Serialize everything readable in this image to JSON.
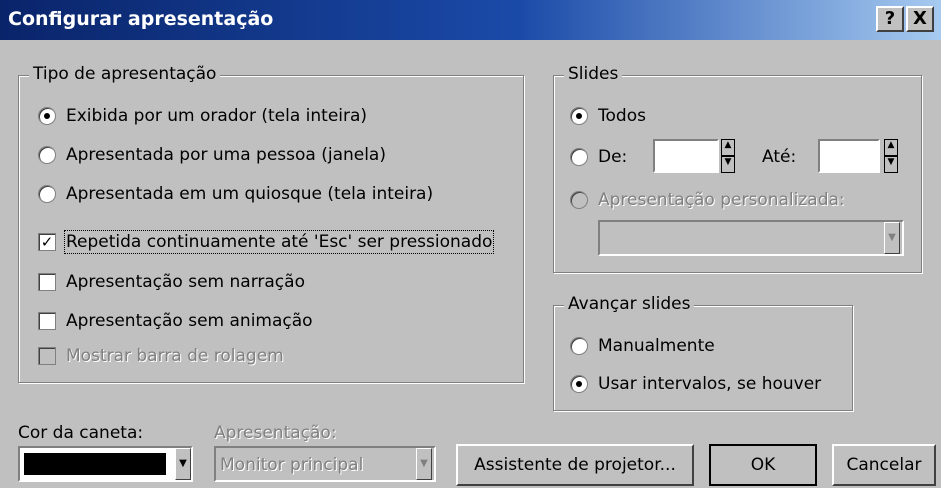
{
  "dialog": {
    "title": "Configurar apresentação",
    "help_label": "?",
    "close_label": "X"
  },
  "show_type": {
    "legend": "Tipo de apresentação",
    "option_speaker": "Exibida por um orador (tela inteira)",
    "option_individual": "Apresentada por uma pessoa (janela)",
    "option_kiosk": "Apresentada em um quiosque (tela inteira)",
    "loop_label": "Repetida continuamente até 'Esc' ser pressionado",
    "no_narration_label": "Apresentação sem narração",
    "no_animation_label": "Apresentação sem animação",
    "scrollbar_label": "Mostrar barra de rolagem",
    "selected": "speaker",
    "loop_checked": true,
    "no_narration_checked": false,
    "no_animation_checked": false,
    "scrollbar_checked": false
  },
  "slides": {
    "legend": "Slides",
    "all_label": "Todos",
    "from_label": "De:",
    "to_label": "Até:",
    "from_value": "",
    "to_value": "",
    "custom_label": "Apresentação personalizada:",
    "custom_value": "",
    "selected": "all"
  },
  "advance": {
    "legend": "Avançar slides",
    "manual_label": "Manualmente",
    "timings_label": "Usar intervalos, se houver",
    "selected": "timings"
  },
  "pen": {
    "label": "Cor da caneta:",
    "color": "#000000"
  },
  "monitor": {
    "label": "Apresentação:",
    "value": "Monitor principal"
  },
  "buttons": {
    "projector": "Assistente de projetor...",
    "ok": "OK",
    "cancel": "Cancelar"
  }
}
